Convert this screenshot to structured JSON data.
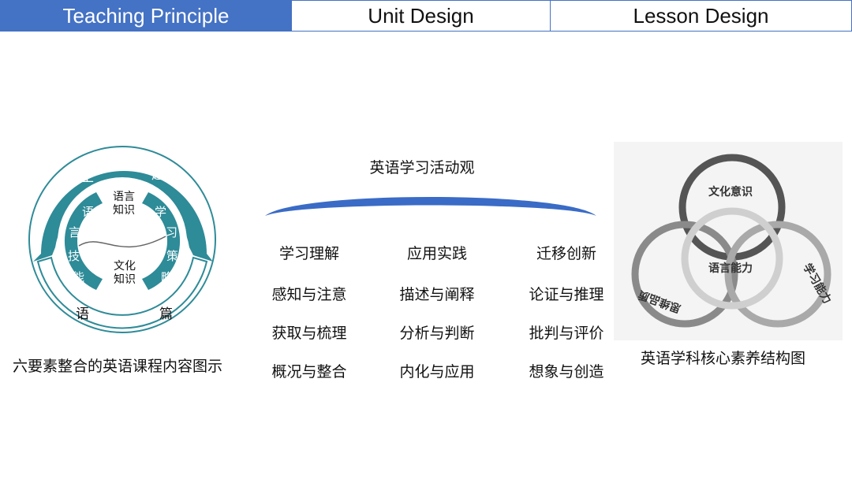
{
  "tabs": [
    {
      "label": "Teaching Principle",
      "active": true
    },
    {
      "label": "Unit Design",
      "active": false
    },
    {
      "label": "Lesson Design",
      "active": false
    }
  ],
  "colors": {
    "accent": "#4472c4",
    "teal": "#2e8b98",
    "arc_blue": "#3a6bc6"
  },
  "left_diagram": {
    "outer_top": [
      "主",
      "题"
    ],
    "outer_bottom": [
      "语",
      "篇"
    ],
    "left_arc": [
      "语",
      "言",
      "技",
      "能"
    ],
    "right_arc": [
      "学",
      "习",
      "策",
      "略"
    ],
    "center_top": "语言\n知识",
    "center_bottom": "文化\n知识",
    "caption": "六要素整合的英语课程内容图示"
  },
  "middle": {
    "title": "英语学习活动观",
    "columns": [
      {
        "head": "学习理解",
        "items": [
          "感知与注意",
          "获取与梳理",
          "概况与整合"
        ]
      },
      {
        "head": "应用实践",
        "items": [
          "描述与阐释",
          "分析与判断",
          "内化与应用"
        ]
      },
      {
        "head": "迁移创新",
        "items": [
          "论证与推理",
          "批判与评价",
          "想象与创造"
        ]
      }
    ]
  },
  "right_diagram": {
    "circle_top": "文化意识",
    "circle_center": "语言能力",
    "circle_left": "思维品质",
    "circle_right": "学习能力",
    "caption": "英语学科核心素养结构图"
  }
}
